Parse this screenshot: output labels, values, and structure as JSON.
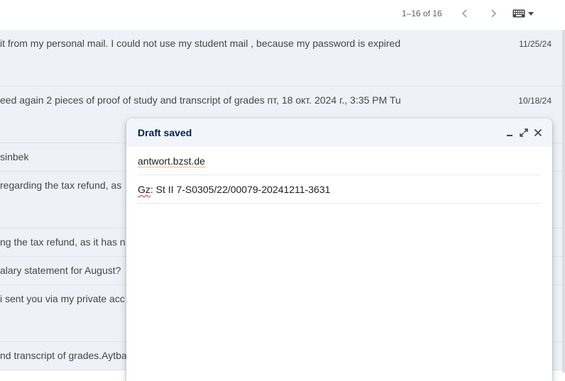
{
  "toolbar": {
    "pager": "1–16 of 16",
    "prev_icon": "chevron-left-icon",
    "next_icon": "chevron-right-icon",
    "keyboard_icon": "keyboard-icon"
  },
  "emails": [
    {
      "snippet": "it from my personal mail. I could not use my student mail , because my password is expired",
      "date": "11/25/24"
    },
    {
      "snippet": "eed again 2 pieces of proof of study and transcript of grades пт, 18 окт. 2024 г., 3:35 PM Tu",
      "date": "10/18/24"
    },
    {
      "snippet": "sinbek",
      "date": ""
    },
    {
      "snippet": "regarding the tax refund, as",
      "date": ""
    },
    {
      "snippet": "ng the tax refund, as it has n",
      "date": ""
    },
    {
      "snippet": "alary statement for August?",
      "date": ""
    },
    {
      "snippet": "i sent you via my private acc",
      "date": ""
    },
    {
      "snippet": "nd transcript of grades.Aytba",
      "date": ""
    }
  ],
  "compose": {
    "title": "Draft saved",
    "to": "antwort.bzst.de",
    "subject_prefix": "Gz",
    "subject_rest": ": St II 7-S0305/22/00079-20241211-3631"
  },
  "colors": {
    "row_bg": "#eef2f8",
    "compose_header_bg": "#f2f6fc",
    "title_color": "#041e49",
    "spell_underline": "#d93025"
  }
}
